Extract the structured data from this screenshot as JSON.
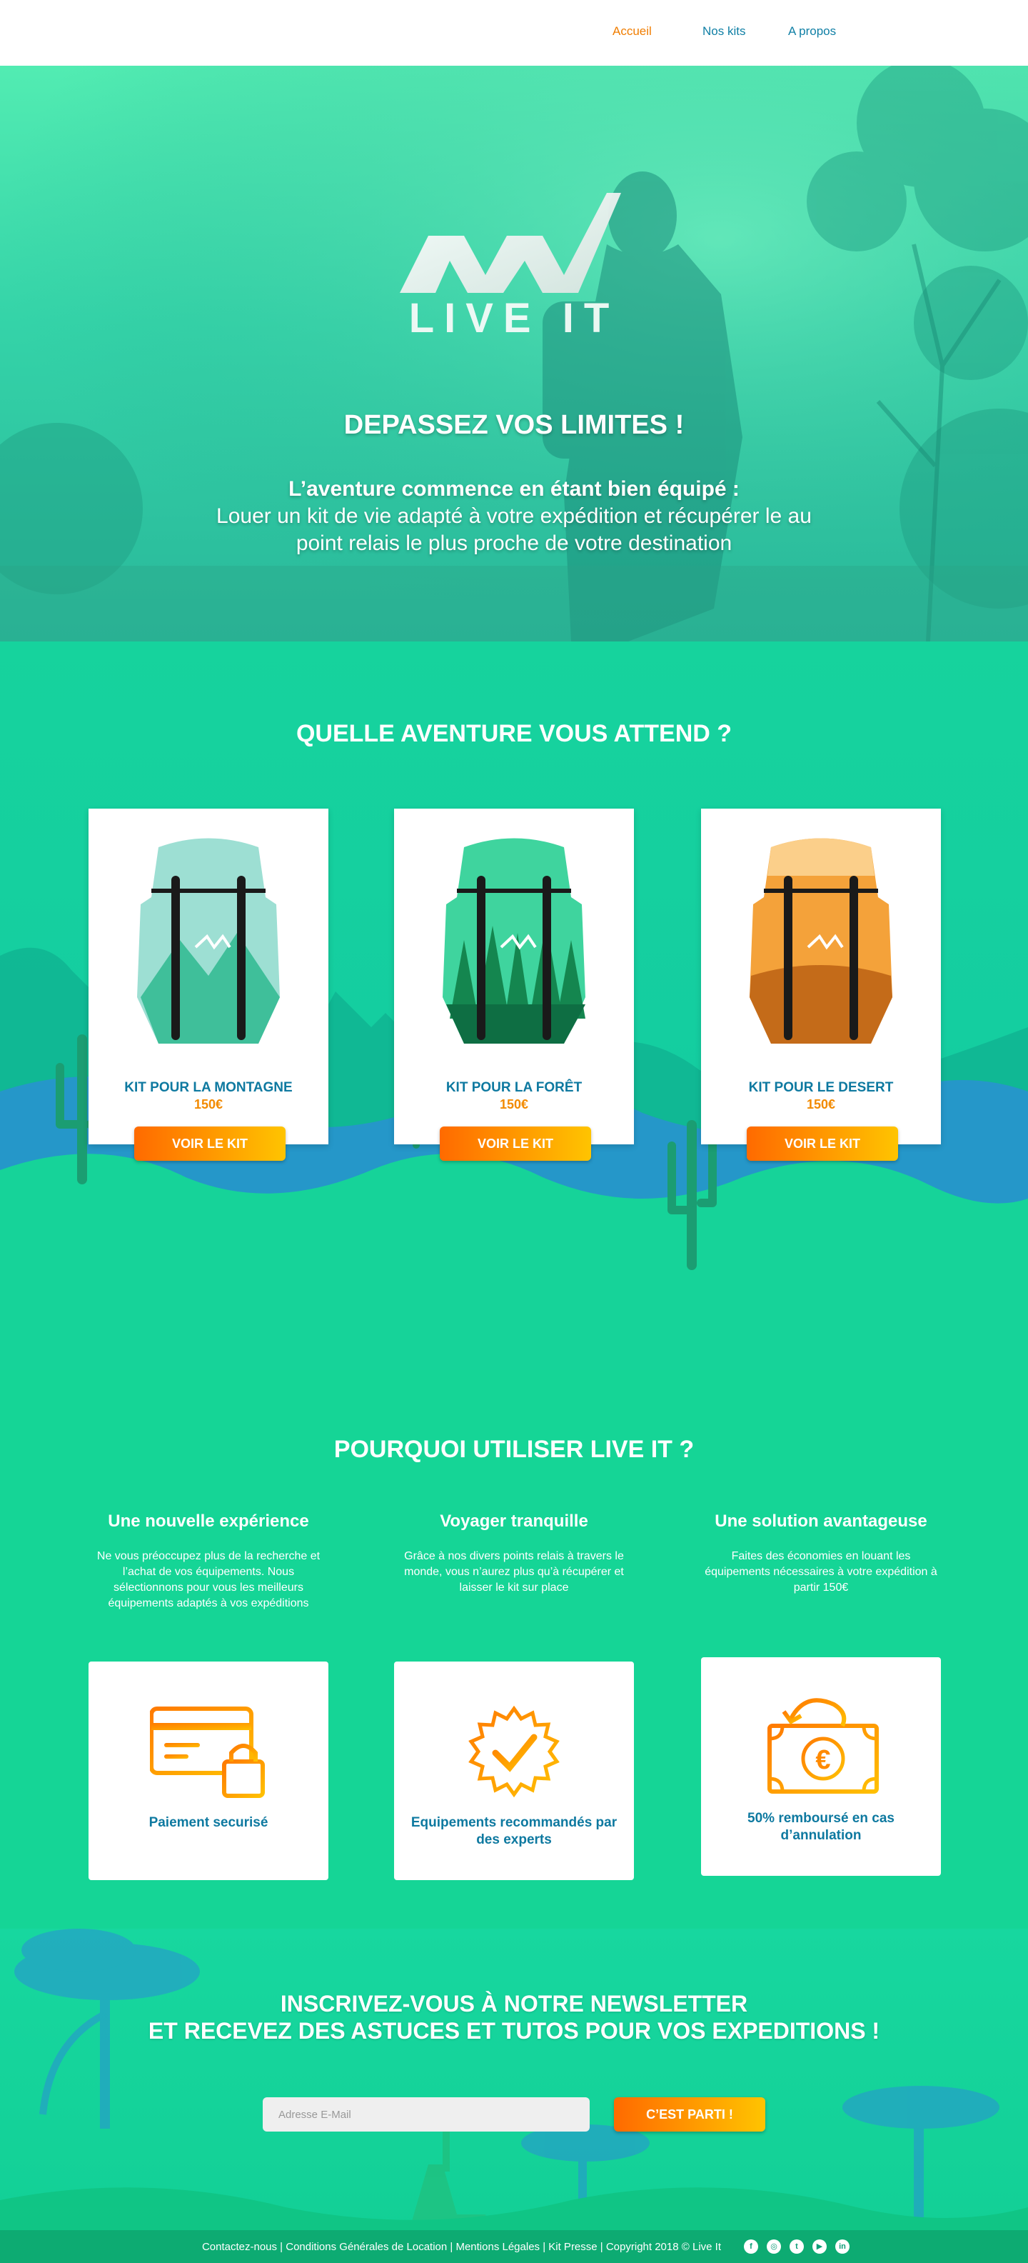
{
  "nav": {
    "items": [
      {
        "label": "Accueil",
        "active": true
      },
      {
        "label": "Nos kits",
        "active": false
      },
      {
        "label": "A propos",
        "active": false
      }
    ]
  },
  "hero": {
    "logo_text": "LIVE IT",
    "title": "DEPASSEZ VOS LIMITES !",
    "subtitle_bold": "L’aventure commence en étant bien équipé :",
    "subtitle_rest": "Louer un kit de vie adapté à votre expédition et récupérer le au point relais le plus proche de votre destination",
    "scroll_icon": "chevron-down-icon"
  },
  "adventure": {
    "title": "QUELLE AVENTURE VOUS ATTEND ?",
    "kits": [
      {
        "label": "KIT POUR LA MONTAGNE",
        "price": "150€",
        "button": "VOIR LE KIT",
        "scene": "mountain"
      },
      {
        "label": "KIT POUR LA FORÊT",
        "price": "150€",
        "button": "VOIR LE KIT",
        "scene": "forest"
      },
      {
        "label": "KIT POUR LE DESERT",
        "price": "150€",
        "button": "VOIR LE KIT",
        "scene": "desert"
      }
    ]
  },
  "why": {
    "title": "POURQUOI UTILISER LIVE IT ?",
    "columns": [
      {
        "heading": "Une nouvelle expérience",
        "text": "Ne vous préoccupez plus de la recherche et l’achat de vos équipements. Nous sélectionnons pour vous les meilleurs équipements adaptés à vos expéditions"
      },
      {
        "heading": "Voyager tranquille",
        "text": "Grâce à nos divers points relais à travers le monde, vous n’aurez plus qu’à récupérer et laisser le kit sur place"
      },
      {
        "heading": "Une solution avantageuse",
        "text": "Faites des économies en louant les équipements nécessaires à votre expédition à partir 150€"
      }
    ],
    "features": [
      {
        "label": "Paiement securisé",
        "icon": "secure-card-icon"
      },
      {
        "label": "Equipements recommandés par des experts",
        "icon": "badge-check-icon"
      },
      {
        "label": "50% remboursé en cas d’annulation",
        "icon": "euro-refund-icon"
      }
    ]
  },
  "newsletter": {
    "title_line1": "INSCRIVEZ-VOUS À NOTRE NEWSLETTER",
    "title_line2": "ET RECEVEZ DES ASTUCES ET TUTOS POUR VOS EXPEDITIONS !",
    "placeholder": "Adresse E-Mail",
    "button": "C’EST PARTI !"
  },
  "footer": {
    "text": "Contactez-nous | Conditions Générales de Location | Mentions Légales | Kit Presse | Copyright 2018 © Live It",
    "social": [
      {
        "icon": "facebook-icon",
        "glyph": "f"
      },
      {
        "icon": "instagram-icon",
        "glyph": "◎"
      },
      {
        "icon": "twitter-icon",
        "glyph": "t"
      },
      {
        "icon": "vimeo-icon",
        "glyph": "▶"
      },
      {
        "icon": "linkedin-icon",
        "glyph": "in"
      }
    ]
  },
  "colors": {
    "accent_orange": "#f07d00",
    "link_blue": "#0f7fa5",
    "background_green": "#15d596",
    "button_gradient_start": "#ff6a00",
    "button_gradient_end": "#ffc400"
  }
}
